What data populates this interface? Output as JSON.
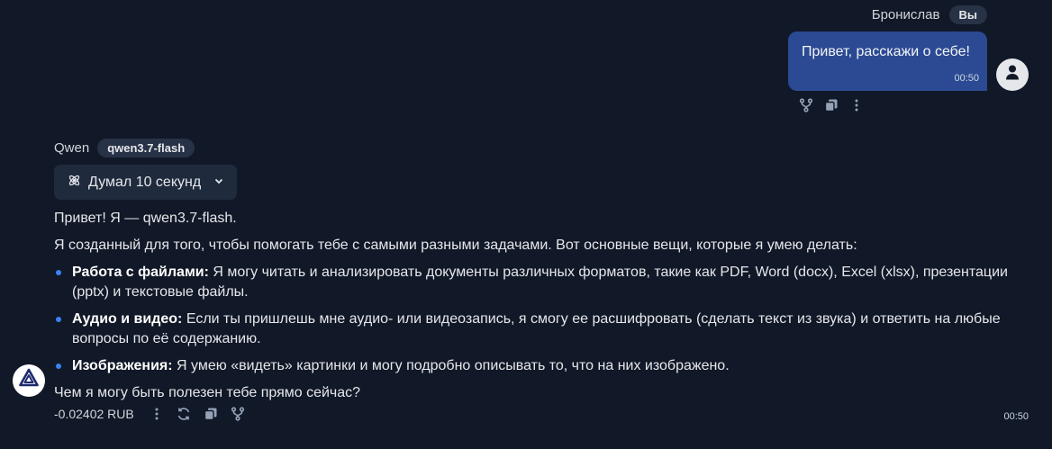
{
  "user": {
    "name": "Бронислав",
    "badge": "Вы",
    "message": "Привет, расскажи о себе!",
    "time": "00:50",
    "action_icons": [
      "branch-icon",
      "copy-icon",
      "more-vertical-icon"
    ]
  },
  "assistant": {
    "name": "Qwen",
    "model": "qwen3.7-flash",
    "thinking_label": "Думал 10 секунд",
    "greeting": "Привет! Я — qwen3.7-flash.",
    "intro": "Я созданный для того, чтобы помогать тебе с самыми разными задачами. Вот основные вещи, которые я умею делать:",
    "items": [
      {
        "title": "Работа с файлами:",
        "text": " Я могу читать и анализировать документы различных форматов, такие как PDF, Word (docx), Excel (xlsx), презентации (pptx) и текстовые файлы."
      },
      {
        "title": "Аудио и видео:",
        "text": " Если ты пришлешь мне аудио- или видеозапись, я смогу ее расшифровать (сделать текст из звука) и ответить на любые вопросы по её содержанию."
      },
      {
        "title": "Изображения:",
        "text": " Я умею «видеть» картинки и могу подробно описывать то, что на них изображено."
      }
    ],
    "question": "Чем я могу быть полезен тебе прямо сейчас?",
    "cost": "-0.02402 RUB",
    "time": "00:50",
    "footer_icons": [
      "more-vertical-icon",
      "regenerate-icon",
      "copy-icon",
      "branch-icon"
    ]
  },
  "colors": {
    "background": "#111827",
    "user_bubble": "#2b4a93",
    "badge": "#273246",
    "bullet": "#3b82f6"
  }
}
